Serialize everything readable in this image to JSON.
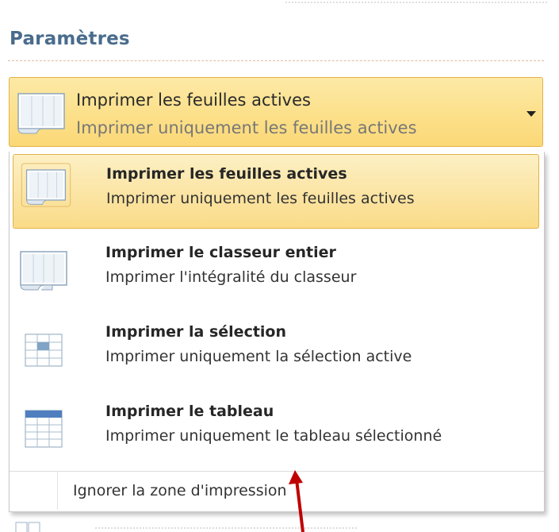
{
  "settings": {
    "section_title": "Paramètres"
  },
  "dropdown": {
    "selected_title": "Imprimer les feuilles actives",
    "selected_description": "Imprimer uniquement les feuilles actives",
    "icon": "active-sheets-icon"
  },
  "menu": {
    "items": [
      {
        "title": "Imprimer les feuilles actives",
        "description": "Imprimer uniquement les feuilles actives",
        "icon": "active-sheets-icon",
        "selected": true
      },
      {
        "title": "Imprimer le classeur entier",
        "description": "Imprimer l'intégralité du classeur",
        "icon": "workbook-icon",
        "selected": false
      },
      {
        "title": "Imprimer la sélection",
        "description": "Imprimer uniquement la sélection active",
        "icon": "selection-icon",
        "selected": false
      },
      {
        "title": "Imprimer le tableau",
        "description": "Imprimer uniquement le tableau sélectionné",
        "icon": "table-icon",
        "selected": false
      }
    ],
    "ignore_print_area": "Ignorer la zone d'impression"
  },
  "colors": {
    "title_blue": "#4a6c8c",
    "hover_gold": "#fce08a",
    "hover_border": "#e3b24a",
    "annotation_arrow": "#c00000"
  }
}
